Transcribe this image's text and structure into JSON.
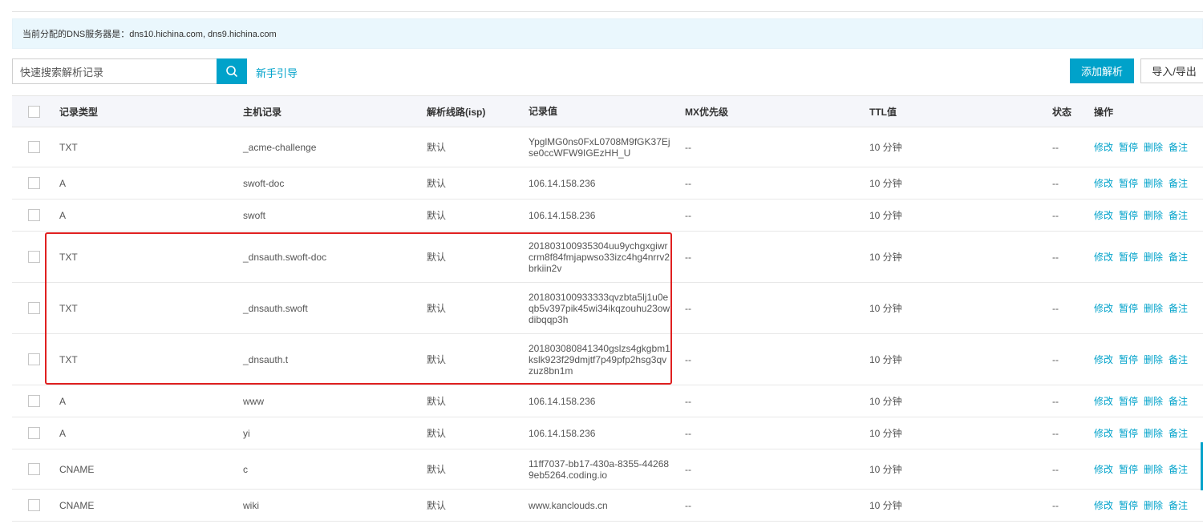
{
  "dns_notice": "当前分配的DNS服务器是：dns10.hichina.com, dns9.hichina.com",
  "toolbar": {
    "search_placeholder": "快速搜索解析记录",
    "guide_link": "新手引导",
    "add_button": "添加解析",
    "import_export_button": "导入/导出"
  },
  "table": {
    "headers": {
      "type": "记录类型",
      "host": "主机记录",
      "line": "解析线路(isp)",
      "value": "记录值",
      "mx": "MX优先级",
      "ttl": "TTL值",
      "status": "状态",
      "ops": "操作"
    },
    "actions": {
      "edit": "修改",
      "pause": "暂停",
      "delete": "删除",
      "remark": "备注"
    },
    "rows": [
      {
        "type": "TXT",
        "host": "_acme-challenge",
        "line": "默认",
        "value": "YpglMG0ns0FxL0708M9fGK37Ejse0ccWFW9IGEzHH_U",
        "mx": "--",
        "ttl": "10 分钟",
        "status": "--"
      },
      {
        "type": "A",
        "host": "swoft-doc",
        "line": "默认",
        "value": "106.14.158.236",
        "mx": "--",
        "ttl": "10 分钟",
        "status": "--"
      },
      {
        "type": "A",
        "host": "swoft",
        "line": "默认",
        "value": "106.14.158.236",
        "mx": "--",
        "ttl": "10 分钟",
        "status": "--"
      },
      {
        "type": "TXT",
        "host": "_dnsauth.swoft-doc",
        "line": "默认",
        "value": "201803100935304uu9ychgxgiwrcrm8f84fmjapwso33izc4hg4nrrv2brkiin2v",
        "mx": "--",
        "ttl": "10 分钟",
        "status": "--"
      },
      {
        "type": "TXT",
        "host": "_dnsauth.swoft",
        "line": "默认",
        "value": "201803100933333qvzbta5lj1u0eqb5v397pik45wi34ikqzouhu23owdibqqp3h",
        "mx": "--",
        "ttl": "10 分钟",
        "status": "--"
      },
      {
        "type": "TXT",
        "host": "_dnsauth.t",
        "line": "默认",
        "value": "201803080841340gslzs4gkgbm1kslk923f29dmjtf7p49pfp2hsg3qvzuz8bn1m",
        "mx": "--",
        "ttl": "10 分钟",
        "status": "--"
      },
      {
        "type": "A",
        "host": "www",
        "line": "默认",
        "value": "106.14.158.236",
        "mx": "--",
        "ttl": "10 分钟",
        "status": "--"
      },
      {
        "type": "A",
        "host": "yi",
        "line": "默认",
        "value": "106.14.158.236",
        "mx": "--",
        "ttl": "10 分钟",
        "status": "--"
      },
      {
        "type": "CNAME",
        "host": "c",
        "line": "默认",
        "value": "11ff7037-bb17-430a-8355-442689eb5264.coding.io",
        "mx": "--",
        "ttl": "10 分钟",
        "status": "--"
      },
      {
        "type": "CNAME",
        "host": "wiki",
        "line": "默认",
        "value": "www.kanclouds.cn",
        "mx": "--",
        "ttl": "10 分钟",
        "status": "--"
      }
    ]
  },
  "colors": {
    "accent": "#00a2ca",
    "notice_bg": "#eaf7fd",
    "highlight": "#e02020"
  }
}
